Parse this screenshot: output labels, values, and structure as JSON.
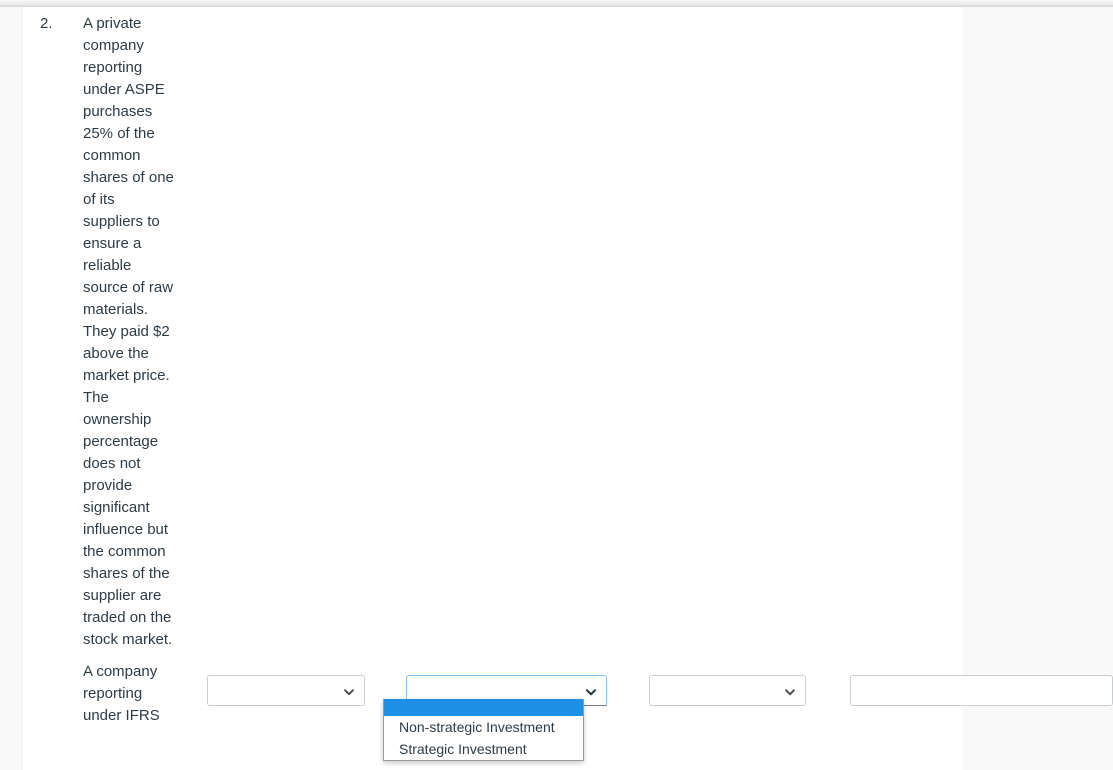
{
  "question": {
    "number": "2.",
    "paragraphs": [
      "A private company reporting under ASPE purchases 25% of the common shares of one of its suppliers to ensure a reliable source of raw materials. They paid $2 above the market price. The ownership percentage does not provide significant influence but the common shares of the supplier are traded on the stock market.",
      "A company reporting under IFRS"
    ]
  },
  "answer_row": {
    "select_1": {
      "value": "",
      "icon": "chevron-down-icon"
    },
    "select_2": {
      "value": "",
      "icon": "chevron-down-icon",
      "state": "open",
      "options": [
        "",
        "Non-strategic Investment",
        "Strategic Investment"
      ],
      "highlighted_index": 0
    },
    "select_3": {
      "value": "",
      "icon": "chevron-down-icon"
    },
    "text_input_1": {
      "value": "",
      "placeholder": ""
    }
  },
  "colors": {
    "text": "#2d3b45",
    "highlight_blue": "#1e90e6",
    "focus_border": "#80c2f2",
    "control_border": "#c7cdd1",
    "page_background": "#f8f8f8",
    "sheet_background": "#ffffff"
  }
}
